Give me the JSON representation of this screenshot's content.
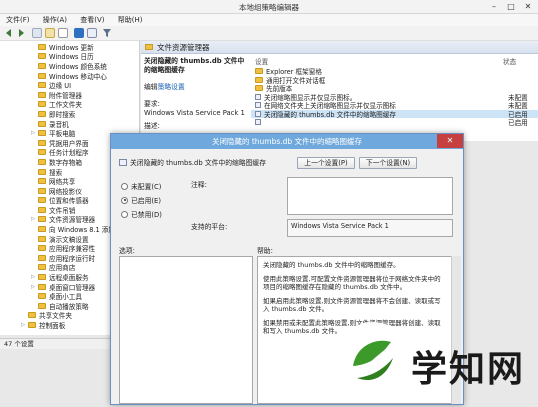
{
  "window": {
    "title": "本地组策略编辑器",
    "minimize": "–",
    "maximize": "□",
    "close": "✕"
  },
  "menu": [
    "文件(F)",
    "操作(A)",
    "查看(V)",
    "帮助(H)"
  ],
  "tree": {
    "items": [
      {
        "label": "Windows 更新",
        "expander": ""
      },
      {
        "label": "Windows 日历",
        "expander": ""
      },
      {
        "label": "Windows 颜色系统",
        "expander": ""
      },
      {
        "label": "Windows 移动中心",
        "expander": ""
      },
      {
        "label": "边缘 UI",
        "expander": ""
      },
      {
        "label": "附件管理器",
        "expander": ""
      },
      {
        "label": "工作文件夹",
        "expander": ""
      },
      {
        "label": "即时搜索",
        "expander": ""
      },
      {
        "label": "录音机",
        "expander": ""
      },
      {
        "label": "平板电脑",
        "expander": "▷"
      },
      {
        "label": "凭据用户界面",
        "expander": ""
      },
      {
        "label": "任务计划程序",
        "expander": ""
      },
      {
        "label": "数字存物箱",
        "expander": ""
      },
      {
        "label": "搜索",
        "expander": ""
      },
      {
        "label": "网络共享",
        "expander": ""
      },
      {
        "label": "网络投影仪",
        "expander": ""
      },
      {
        "label": "位置和传感器",
        "expander": ""
      },
      {
        "label": "文件吊销",
        "expander": ""
      },
      {
        "label": "文件资源管理器",
        "expander": "▷"
      },
      {
        "label": "向 Windows 8.1 添加",
        "expander": ""
      },
      {
        "label": "演示文稿设置",
        "expander": ""
      },
      {
        "label": "应用程序兼容性",
        "expander": ""
      },
      {
        "label": "应用程序运行时",
        "expander": ""
      },
      {
        "label": "应用商店",
        "expander": ""
      },
      {
        "label": "远程桌面服务",
        "expander": "▷"
      },
      {
        "label": "桌面窗口管理器",
        "expander": "▷"
      },
      {
        "label": "桌面小工具",
        "expander": ""
      },
      {
        "label": "自动播放策略",
        "expander": ""
      },
      {
        "label": "共享文件夹",
        "expander": ""
      },
      {
        "label": "控制面板",
        "expander": "▷"
      }
    ],
    "status": "47 个设置"
  },
  "right": {
    "header": "文件资源管理器",
    "detail_title": "关闭隐藏的 thumbs.db 文件中的缩略图缓存",
    "edit_prefix": "编辑",
    "edit_link": "策略设置",
    "req_label": "要求:",
    "req_value": "Windows Vista Service Pack 1",
    "desc_label": "描述:",
    "col_setting": "设置",
    "col_state": "状态",
    "rows": [
      {
        "label": "Explorer 框架窗格",
        "state": "",
        "folder": true
      },
      {
        "label": "通用打开文件对话框",
        "state": "",
        "folder": true
      },
      {
        "label": "先前版本",
        "state": "",
        "folder": true
      },
      {
        "label": "关闭缩略图显示并仅显示图标。",
        "state": "未配置",
        "folder": false
      },
      {
        "label": "在网络文件夹上关闭缩略图显示并仅显示图标",
        "state": "未配置",
        "folder": false
      },
      {
        "label": "关闭隐藏的 thumbs.db 文件中的缩略图缓存",
        "state": "已启用",
        "folder": false,
        "selected": true
      },
      {
        "label": "",
        "state": "已启用",
        "folder": false
      }
    ]
  },
  "dialog": {
    "title": "关闭隐藏的 thumbs.db 文件中的缩略图缓存",
    "subtitle": "关闭隐藏的 thumbs.db 文件中的缩略图缓存",
    "prev_btn": "上一个设置(P)",
    "next_btn": "下一个设置(N)",
    "radio_not_configured": "未配置(C)",
    "radio_enabled": "已启用(E)",
    "radio_disabled": "已禁用(D)",
    "comment_label": "注释:",
    "platform_label": "支持的平台:",
    "platform_value": "Windows Vista Service Pack 1",
    "options_label": "选项:",
    "help_label": "帮助:",
    "help_paragraphs": [
      "关闭隐藏的 thumbs.db 文件中的缩略图缓存。",
      "使用此策略设置,可配置文件资源管理器将位于网络文件夹中的项目的缩略图缓存在隐藏的 thumbs.db 文件中。",
      "如果启用此策略设置,则文件资源管理器将不会创建、读取或写入 thumbs.db 文件。",
      "如果禁用或未配置此策略设置,则文件资源管理器将创建、读取和写入 thumbs.db 文件。"
    ]
  },
  "watermark": {
    "text": "学知网"
  },
  "colors": {
    "accent": "#6fa8dc",
    "logo_green": "#3c9a2a",
    "logo_dark": "#1a1a1a"
  }
}
